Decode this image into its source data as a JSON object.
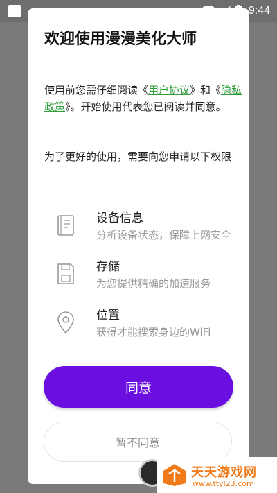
{
  "status_bar": {
    "time": "9:44"
  },
  "dialog": {
    "title": "欢迎使用漫漫美化大师",
    "intro_prefix": "使用前您需仔细阅读《",
    "user_agreement": "用户协议",
    "intro_mid": "》和《",
    "privacy_policy": "隐私政策",
    "intro_suffix": "》。开始使用代表您已阅读并同意。",
    "permission_request": "为了更好的使用，需要向您申请以下权限",
    "permissions": [
      {
        "title": "设备信息",
        "desc": "分析设备状态，保障上网安全",
        "icon": "device-info-icon"
      },
      {
        "title": "存储",
        "desc": "为您提供精确的加速服务",
        "icon": "storage-icon"
      },
      {
        "title": "位置",
        "desc": "获得才能搜索身边的WiFi",
        "icon": "location-pin-icon"
      }
    ],
    "agree_label": "同意",
    "disagree_label": "暂不同意"
  },
  "watermark": {
    "name": "天天游戏网",
    "url": "www.ttyl23.com"
  },
  "colors": {
    "accent": "#6a0fe0",
    "link": "#2e9d3a",
    "watermark": "#f07a19"
  }
}
